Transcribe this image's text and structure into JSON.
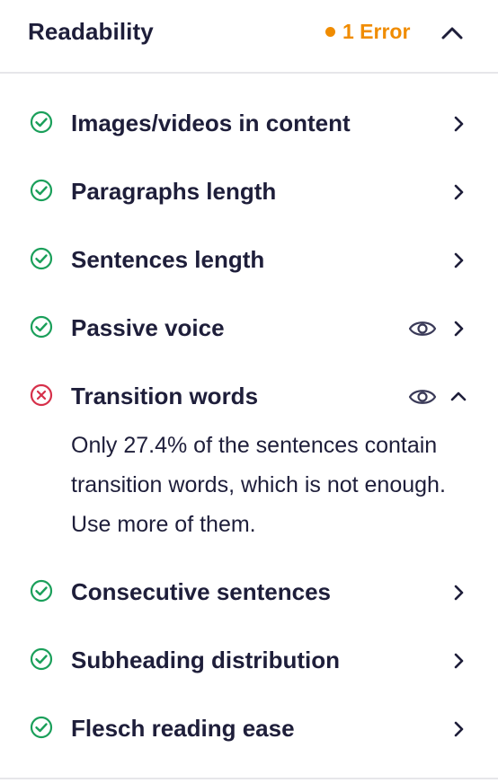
{
  "header": {
    "title": "Readability",
    "error_badge": "1 Error",
    "colors": {
      "error": "#f08c00",
      "good": "#1a9f5a",
      "bad": "#d6304a"
    }
  },
  "items": [
    {
      "label": "Images/videos in content",
      "status": "good",
      "icon": "check-circle-icon"
    },
    {
      "label": "Paragraphs length",
      "status": "good",
      "icon": "check-circle-icon"
    },
    {
      "label": "Sentences length",
      "status": "good",
      "icon": "check-circle-icon"
    },
    {
      "label": "Passive voice",
      "status": "good",
      "icon": "check-circle-icon",
      "has_eye": true
    },
    {
      "label": "Transition words",
      "status": "bad",
      "icon": "x-circle-icon",
      "has_eye": true,
      "expanded": true,
      "description": "Only 27.4% of the sentences contain transition words, which is not enough. Use more of them."
    },
    {
      "label": "Consecutive sentences",
      "status": "good",
      "icon": "check-circle-icon"
    },
    {
      "label": "Subheading distribution",
      "status": "good",
      "icon": "check-circle-icon"
    },
    {
      "label": "Flesch reading ease",
      "status": "good",
      "icon": "check-circle-icon"
    }
  ]
}
